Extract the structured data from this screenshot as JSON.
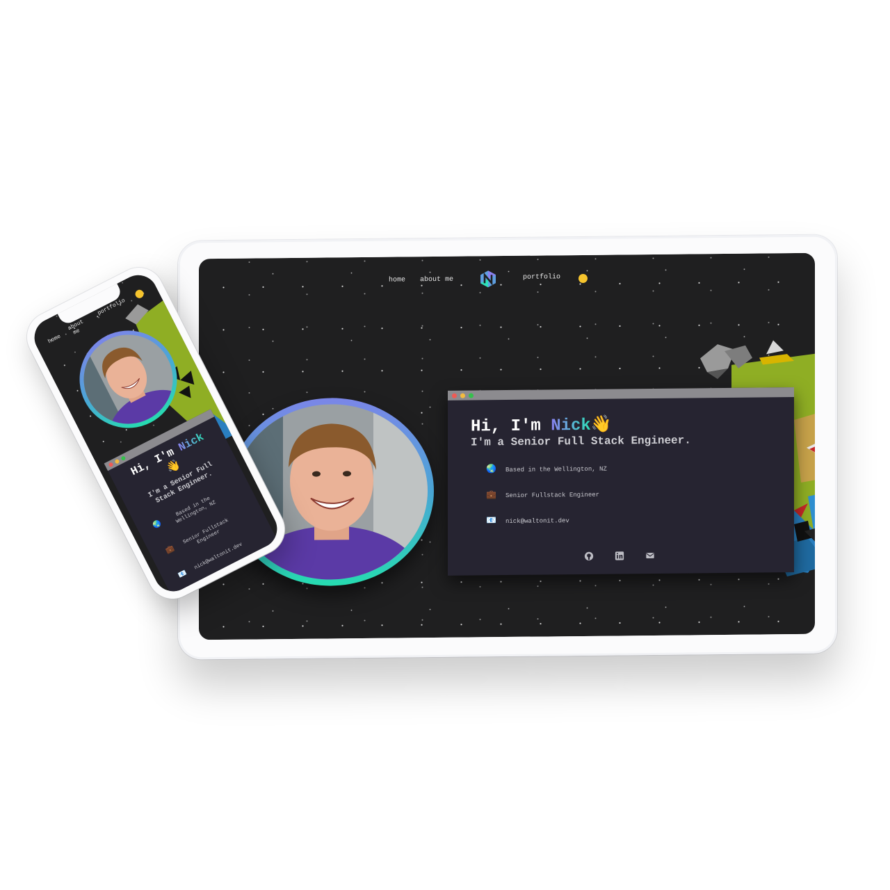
{
  "nav": {
    "home": "home",
    "about": "about me",
    "portfolio": "portfolio"
  },
  "phone_nav": {
    "home": "home",
    "about_line1": "about",
    "about_line2": "me",
    "portfolio": "portfolio"
  },
  "hero": {
    "greeting": "Hi, I'm ",
    "name": "Nick",
    "wave_emoji": "👋",
    "subtitle": "I'm a Senior Full Stack Engineer.",
    "subtitle_line1": "I'm a Senior Full",
    "subtitle_line2": "Stack Engineer."
  },
  "info": [
    {
      "icon": "🌏",
      "text": "Based in the Wellington, NZ"
    },
    {
      "icon": "💼",
      "text": "Senior Fullstack Engineer"
    },
    {
      "icon": "📧",
      "text": "nick@waltonit.dev"
    }
  ],
  "colors": {
    "background": "#1f1f20",
    "window": "#262431",
    "accent_start": "#8b80f0",
    "accent_end": "#2ee0b9",
    "sun": "#f6c42d",
    "window_dots": [
      "#ee5b55",
      "#f4bb3f",
      "#35c04c"
    ]
  },
  "socials": [
    "github-icon",
    "linkedin-icon",
    "email-icon"
  ]
}
